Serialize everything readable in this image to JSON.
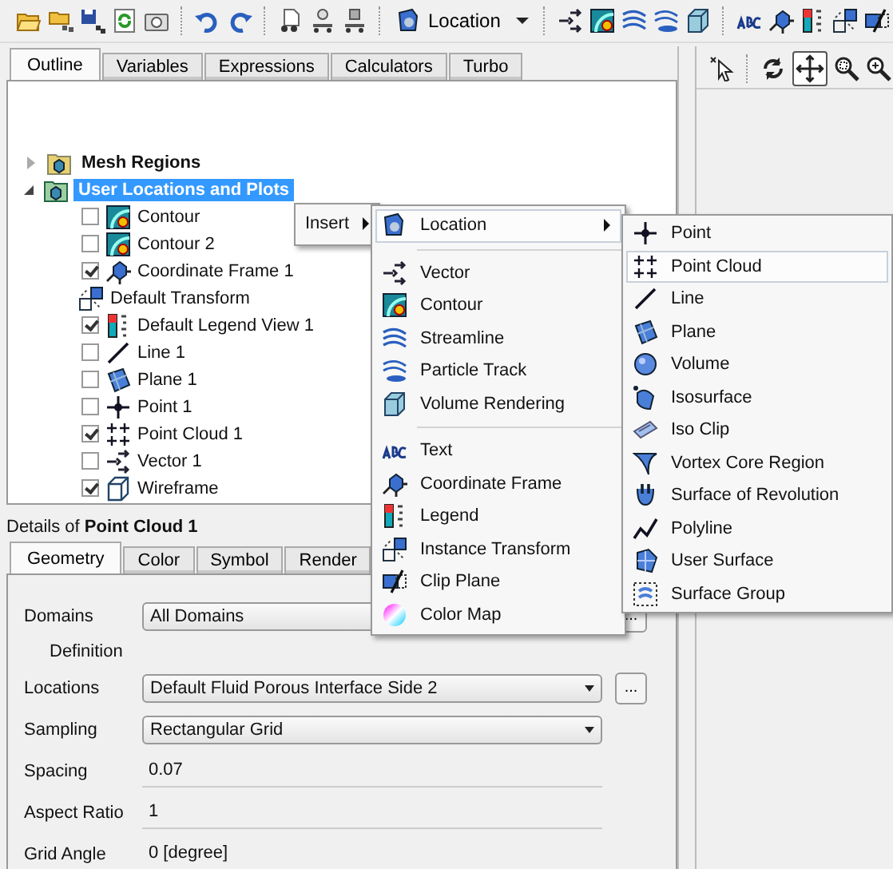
{
  "toolbar": {
    "location_dropdown": "Location"
  },
  "outline_tabs": [
    {
      "label": "Outline",
      "selected": true
    },
    {
      "label": "Variables",
      "selected": false
    },
    {
      "label": "Expressions",
      "selected": false
    },
    {
      "label": "Calculators",
      "selected": false
    },
    {
      "label": "Turbo",
      "selected": false
    }
  ],
  "tree": [
    {
      "label": "Mesh Regions",
      "expanded": false,
      "selected": false
    },
    {
      "label": "User Locations and Plots",
      "expanded": true,
      "selected": true,
      "children": [
        {
          "label": "Contour",
          "kind": "checkbox",
          "checked": false
        },
        {
          "label": "Contour 2",
          "kind": "checkbox",
          "checked": false
        },
        {
          "label": "Coordinate Frame 1",
          "kind": "checkbox",
          "checked": true
        },
        {
          "label": "Default Transform",
          "kind": "plain"
        },
        {
          "label": "Default Legend View 1",
          "kind": "checkbox",
          "checked": true
        },
        {
          "label": "Line 1",
          "kind": "checkbox",
          "checked": false
        },
        {
          "label": "Plane 1",
          "kind": "checkbox",
          "checked": false
        },
        {
          "label": "Point 1",
          "kind": "checkbox",
          "checked": false
        },
        {
          "label": "Point Cloud 1",
          "kind": "checkbox",
          "checked": true
        },
        {
          "label": "Vector 1",
          "kind": "checkbox",
          "checked": false
        },
        {
          "label": "Wireframe",
          "kind": "checkbox",
          "checked": true
        }
      ]
    }
  ],
  "details": {
    "title": "Details of **Point Cloud 1**",
    "tabs": [
      {
        "label": "Geometry",
        "selected": true
      },
      {
        "label": "Color",
        "selected": false
      },
      {
        "label": "Symbol",
        "selected": false
      },
      {
        "label": "Render",
        "selected": false
      }
    ],
    "fields": [
      {
        "kind": "dropdown",
        "label": "Domains",
        "value": "All Domains",
        "browse": "..."
      },
      {
        "kind": "heading",
        "label": "Definition"
      },
      {
        "kind": "dropdown",
        "label": "Locations",
        "value": "Default Fluid Porous Interface Side 2",
        "browse": "..."
      },
      {
        "kind": "dropdown",
        "label": "Sampling",
        "value": "Rectangular Grid"
      },
      {
        "kind": "text",
        "label": "Spacing",
        "value": "0.07"
      },
      {
        "kind": "text",
        "label": "Aspect Ratio",
        "value": "1"
      },
      {
        "kind": "text",
        "label": "Grid Angle",
        "value": "0 [degree]"
      }
    ]
  },
  "context_menu": {
    "items": [
      {
        "label": "Insert",
        "has_submenu": true,
        "highlighted": false
      }
    ]
  },
  "insert_menu": {
    "groups": [
      [
        {
          "label": "Location",
          "has_submenu": true,
          "highlighted": true
        }
      ],
      [
        {
          "label": "Vector",
          "has_submenu": false,
          "highlighted": false
        },
        {
          "label": "Contour",
          "has_submenu": false,
          "highlighted": false
        },
        {
          "label": "Streamline",
          "has_submenu": false,
          "highlighted": false
        },
        {
          "label": "Particle Track",
          "has_submenu": false,
          "highlighted": false
        },
        {
          "label": "Volume Rendering",
          "has_submenu": false,
          "highlighted": false
        }
      ],
      [
        {
          "label": "Text",
          "has_submenu": false,
          "highlighted": false
        },
        {
          "label": "Coordinate Frame",
          "has_submenu": false,
          "highlighted": false
        },
        {
          "label": "Legend",
          "has_submenu": false,
          "highlighted": false
        },
        {
          "label": "Instance Transform",
          "has_submenu": false,
          "highlighted": false
        },
        {
          "label": "Clip Plane",
          "has_submenu": false,
          "highlighted": false
        },
        {
          "label": "Color Map",
          "has_submenu": false,
          "highlighted": false
        }
      ]
    ]
  },
  "location_menu": {
    "items": [
      {
        "label": "Point",
        "highlighted": false
      },
      {
        "label": "Point Cloud",
        "highlighted": true
      },
      {
        "label": "Line",
        "highlighted": false
      },
      {
        "label": "Plane",
        "highlighted": false
      },
      {
        "label": "Volume",
        "highlighted": false
      },
      {
        "label": "Isosurface",
        "highlighted": false
      },
      {
        "label": "Iso Clip",
        "highlighted": false
      },
      {
        "label": "Vortex Core Region",
        "highlighted": false
      },
      {
        "label": "Surface of Revolution",
        "highlighted": false
      },
      {
        "label": "Polyline",
        "highlighted": false
      },
      {
        "label": "User Surface",
        "highlighted": false
      },
      {
        "label": "Surface Group",
        "highlighted": false
      }
    ]
  }
}
